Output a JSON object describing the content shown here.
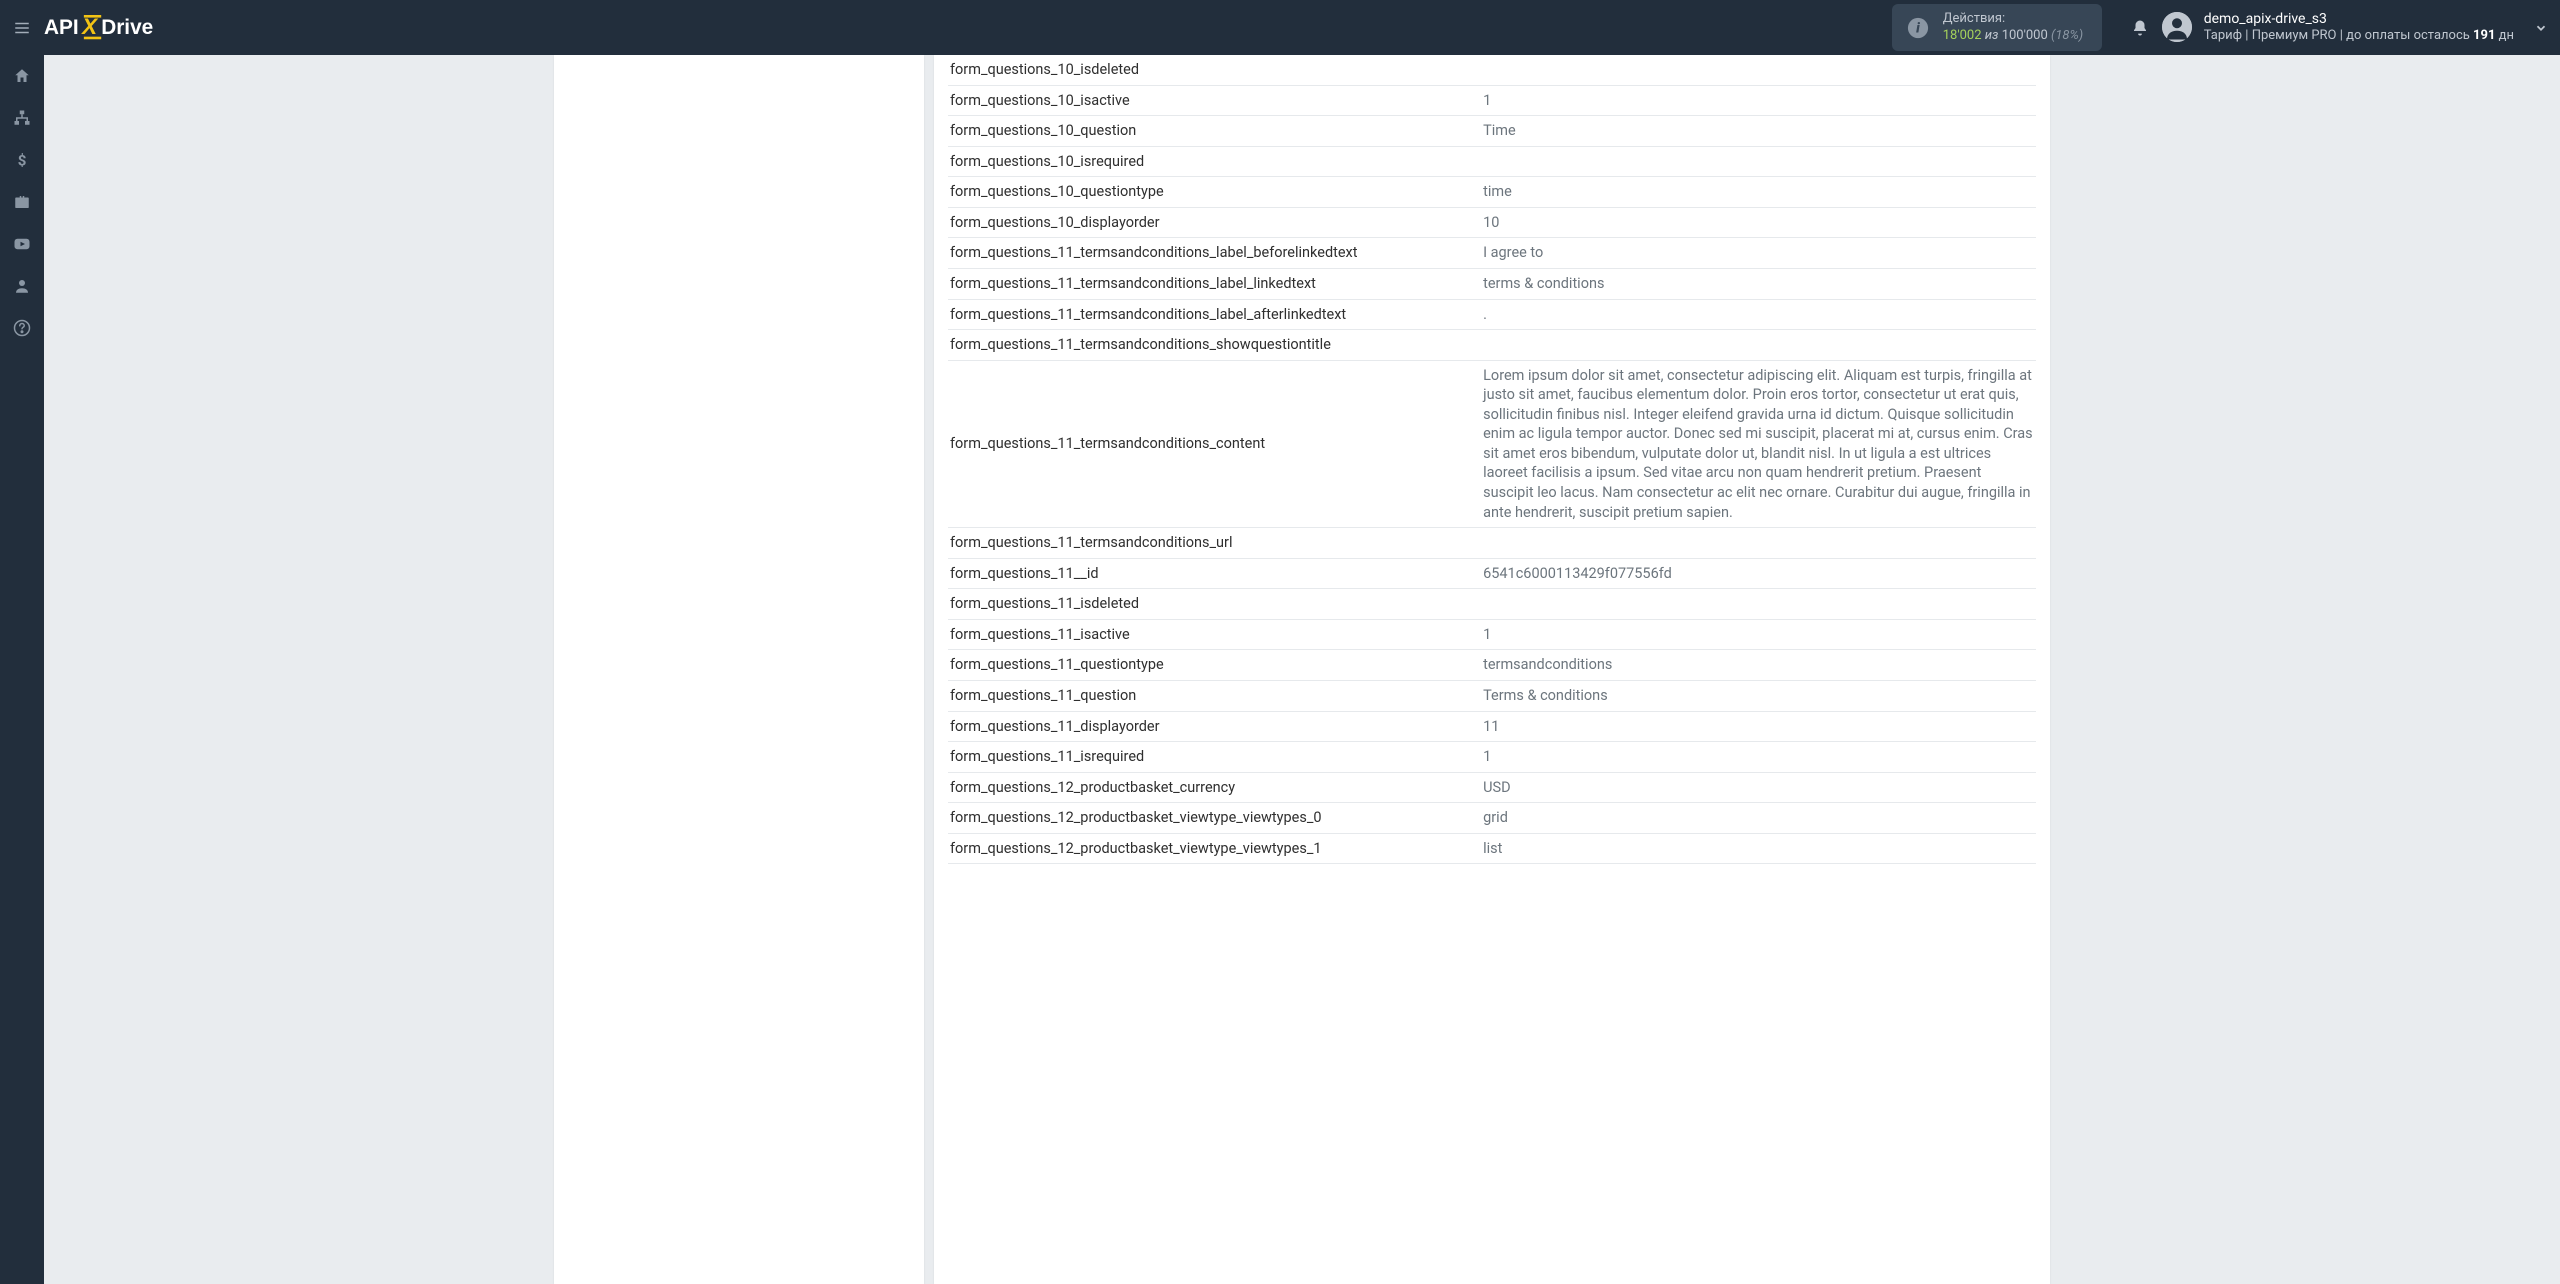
{
  "header": {
    "actions_label": "Действия:",
    "actions_count": "18'002",
    "actions_of": "из",
    "actions_total": "100'000",
    "actions_percent": "(18%)",
    "user_name": "demo_apix-drive_s3",
    "tariff_label": "Тариф |",
    "tariff_name": "Премиум PRO",
    "payment_due_prefix": "| до оплаты осталось",
    "payment_days": "191",
    "payment_days_suffix": "дн"
  },
  "rows": [
    {
      "k": "form_questions_10_isdeleted",
      "v": ""
    },
    {
      "k": "form_questions_10_isactive",
      "v": "1"
    },
    {
      "k": "form_questions_10_question",
      "v": "Time"
    },
    {
      "k": "form_questions_10_isrequired",
      "v": ""
    },
    {
      "k": "form_questions_10_questiontype",
      "v": "time"
    },
    {
      "k": "form_questions_10_displayorder",
      "v": "10"
    },
    {
      "k": "form_questions_11_termsandconditions_label_beforelinkedtext",
      "v": "I agree to"
    },
    {
      "k": "form_questions_11_termsandconditions_label_linkedtext",
      "v": "terms & conditions"
    },
    {
      "k": "form_questions_11_termsandconditions_label_afterlinkedtext",
      "v": "."
    },
    {
      "k": "form_questions_11_termsandconditions_showquestiontitle",
      "v": ""
    },
    {
      "k": "form_questions_11_termsandconditions_content",
      "v": "Lorem ipsum dolor sit amet, consectetur adipiscing elit. Aliquam est turpis, fringilla at justo sit amet, faucibus elementum dolor. Proin eros tortor, consectetur ut erat quis, sollicitudin finibus nisl. Integer eleifend gravida urna id dictum. Quisque sollicitudin enim ac ligula tempor auctor. Donec sed mi suscipit, placerat mi at, cursus enim. Cras sit amet eros bibendum, vulputate dolor ut, blandit nisl. In ut ligula a est ultrices laoreet facilisis a ipsum. Sed vitae arcu non quam hendrerit pretium. Praesent suscipit leo lacus. Nam consectetur ac elit nec ornare. Curabitur dui augue, fringilla in ante hendrerit, suscipit pretium sapien."
    },
    {
      "k": "form_questions_11_termsandconditions_url",
      "v": ""
    },
    {
      "k": "form_questions_11__id",
      "v": "6541c6000113429f077556fd"
    },
    {
      "k": "form_questions_11_isdeleted",
      "v": ""
    },
    {
      "k": "form_questions_11_isactive",
      "v": "1"
    },
    {
      "k": "form_questions_11_questiontype",
      "v": "termsandconditions"
    },
    {
      "k": "form_questions_11_question",
      "v": "Terms & conditions"
    },
    {
      "k": "form_questions_11_displayorder",
      "v": "11"
    },
    {
      "k": "form_questions_11_isrequired",
      "v": "1"
    },
    {
      "k": "form_questions_12_productbasket_currency",
      "v": "USD"
    },
    {
      "k": "form_questions_12_productbasket_viewtype_viewtypes_0",
      "v": "grid"
    },
    {
      "k": "form_questions_12_productbasket_viewtype_viewtypes_1",
      "v": "list"
    }
  ]
}
